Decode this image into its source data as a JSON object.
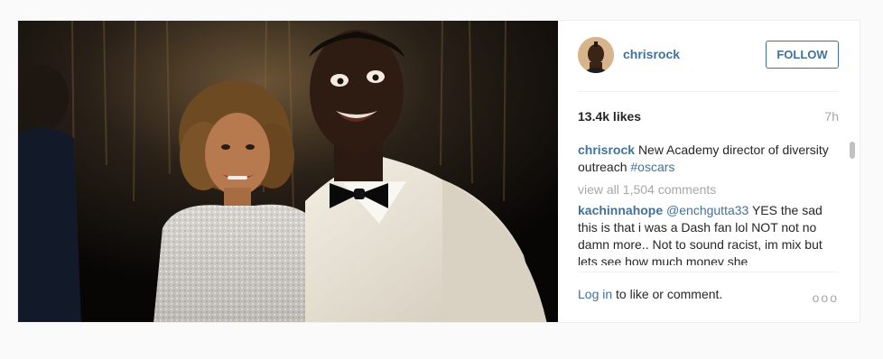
{
  "post": {
    "photo_alt": "",
    "author": {
      "username": "chrisrock",
      "follow_label": "FOLLOW",
      "avatar_icon": "user-avatar"
    },
    "likes": "13.4k likes",
    "time_ago": "7h",
    "caption": {
      "username": "chrisrock",
      "text": "New Academy director of diversity outreach",
      "hashtag": "#oscars"
    },
    "view_all_comments": "view all 1,504 comments",
    "comments": [
      {
        "username": "kachinnahope",
        "mention": "@enchgutta33",
        "text": "YES the sad this is that i was a Dash fan lol NOT not no damn more.. Not to sound racist, im mix but lets see how much money she"
      }
    ],
    "footer": {
      "login_link": "Log in",
      "login_text": "to like or comment.",
      "more_icon": "more-options-icon",
      "more_label": "ooo"
    },
    "colors": {
      "link": "#3f729b",
      "text": "#262626",
      "muted": "#a5a7aa",
      "border": "#efefef",
      "background": "#fafafa"
    }
  }
}
